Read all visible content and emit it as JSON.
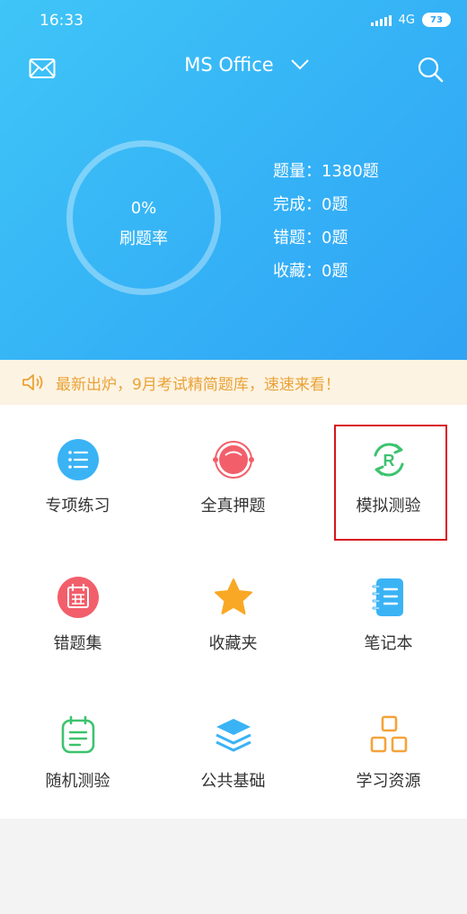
{
  "status_bar": {
    "time": "16:33",
    "network": "4G",
    "battery": "73"
  },
  "header": {
    "title": "MS Office"
  },
  "progress": {
    "rate_value": "0%",
    "rate_label": "刷题率"
  },
  "stats": [
    {
      "label": "题量",
      "sep": "：",
      "value": "1380题"
    },
    {
      "label": "完成",
      "sep": "：",
      "value": "0题"
    },
    {
      "label": "错题",
      "sep": "：",
      "value": "0题"
    },
    {
      "label": "收藏",
      "sep": "：",
      "value": "0题"
    }
  ],
  "notice": {
    "text": "最新出炉，9月考试精简题库，速速来看！"
  },
  "menu": [
    {
      "label": "专项练习",
      "icon": "list-icon"
    },
    {
      "label": "全真押题",
      "icon": "target-icon"
    },
    {
      "label": "模拟测验",
      "icon": "refresh-r-icon"
    },
    {
      "label": "错题集",
      "icon": "calendar-error-icon"
    },
    {
      "label": "收藏夹",
      "icon": "star-icon"
    },
    {
      "label": "笔记本",
      "icon": "notebook-icon"
    },
    {
      "label": "随机测验",
      "icon": "clipboard-icon"
    },
    {
      "label": "公共基础",
      "icon": "layers-icon"
    },
    {
      "label": "学习资源",
      "icon": "blocks-icon"
    }
  ],
  "colors": {
    "hero_top": "#3fc5f7",
    "hero_bottom": "#2fa3f4",
    "notice_bg": "#fdf3e2",
    "notice_text": "#e9a338",
    "highlight": "#d9141b"
  }
}
